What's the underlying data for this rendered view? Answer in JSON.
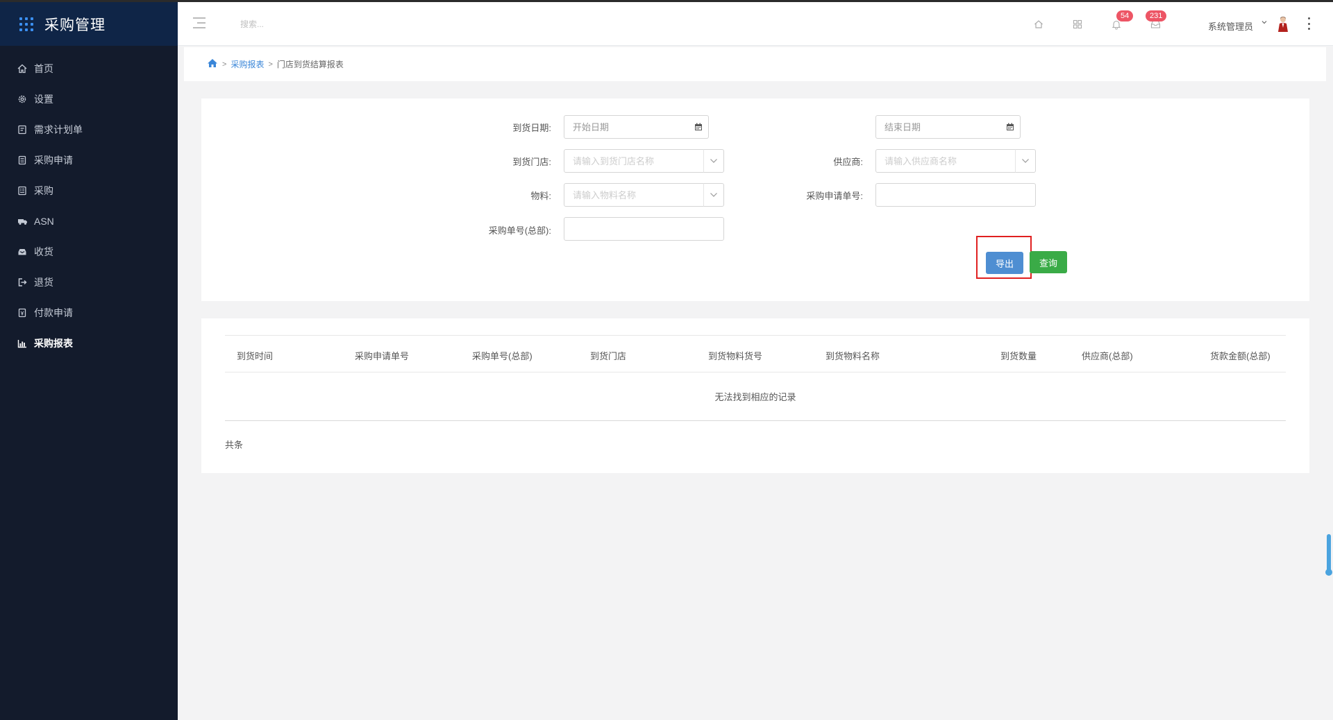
{
  "app": {
    "title": "采购管理"
  },
  "sidebar": {
    "items": [
      {
        "label": "首页",
        "icon": "home-icon"
      },
      {
        "label": "设置",
        "icon": "gear-icon"
      },
      {
        "label": "需求计划单",
        "icon": "edit-doc-icon"
      },
      {
        "label": "采购申请",
        "icon": "clipboard-icon"
      },
      {
        "label": "采购",
        "icon": "list-doc-icon"
      },
      {
        "label": "ASN",
        "icon": "truck-icon"
      },
      {
        "label": "收货",
        "icon": "inbox-icon"
      },
      {
        "label": "退货",
        "icon": "sign-out-icon"
      },
      {
        "label": "付款申请",
        "icon": "receipt-icon"
      },
      {
        "label": "采购报表",
        "icon": "bar-chart-icon",
        "active": true
      }
    ]
  },
  "header": {
    "search_placeholder": "搜索...",
    "notifications_count": "54",
    "messages_count": "231",
    "user_name": "系统管理员"
  },
  "breadcrumb": {
    "parent": "采购报表",
    "current": "门店到货结算报表"
  },
  "filters": {
    "arrival_date_label": "到货日期:",
    "start_date_placeholder": "开始日期",
    "end_date_placeholder": "结束日期",
    "store_label": "到货门店:",
    "store_placeholder": "请输入到货门店名称",
    "supplier_label": "供应商:",
    "supplier_placeholder": "请输入供应商名称",
    "material_label": "物料:",
    "material_placeholder": "请输入物料名称",
    "request_no_label": "采购申请单号:",
    "request_no_value": "",
    "order_no_label": "采购单号(总部):",
    "order_no_value": "",
    "export_label": "导出",
    "query_label": "查询"
  },
  "table": {
    "columns": [
      "到货时间",
      "采购申请单号",
      "采购单号(总部)",
      "到货门店",
      "到货物料货号",
      "到货物料名称",
      "到货数量",
      "供应商(总部)",
      "货款金额(总部)"
    ],
    "empty_text": "无法找到相应的记录",
    "footer_text": "共条"
  },
  "colors": {
    "sidebar_bg": "#131b2c",
    "brand_bg": "#0f2547",
    "accent_blue": "#4e8ed2",
    "accent_green": "#3aab47",
    "badge_red": "#ed5565",
    "highlight_red": "#e02020"
  }
}
